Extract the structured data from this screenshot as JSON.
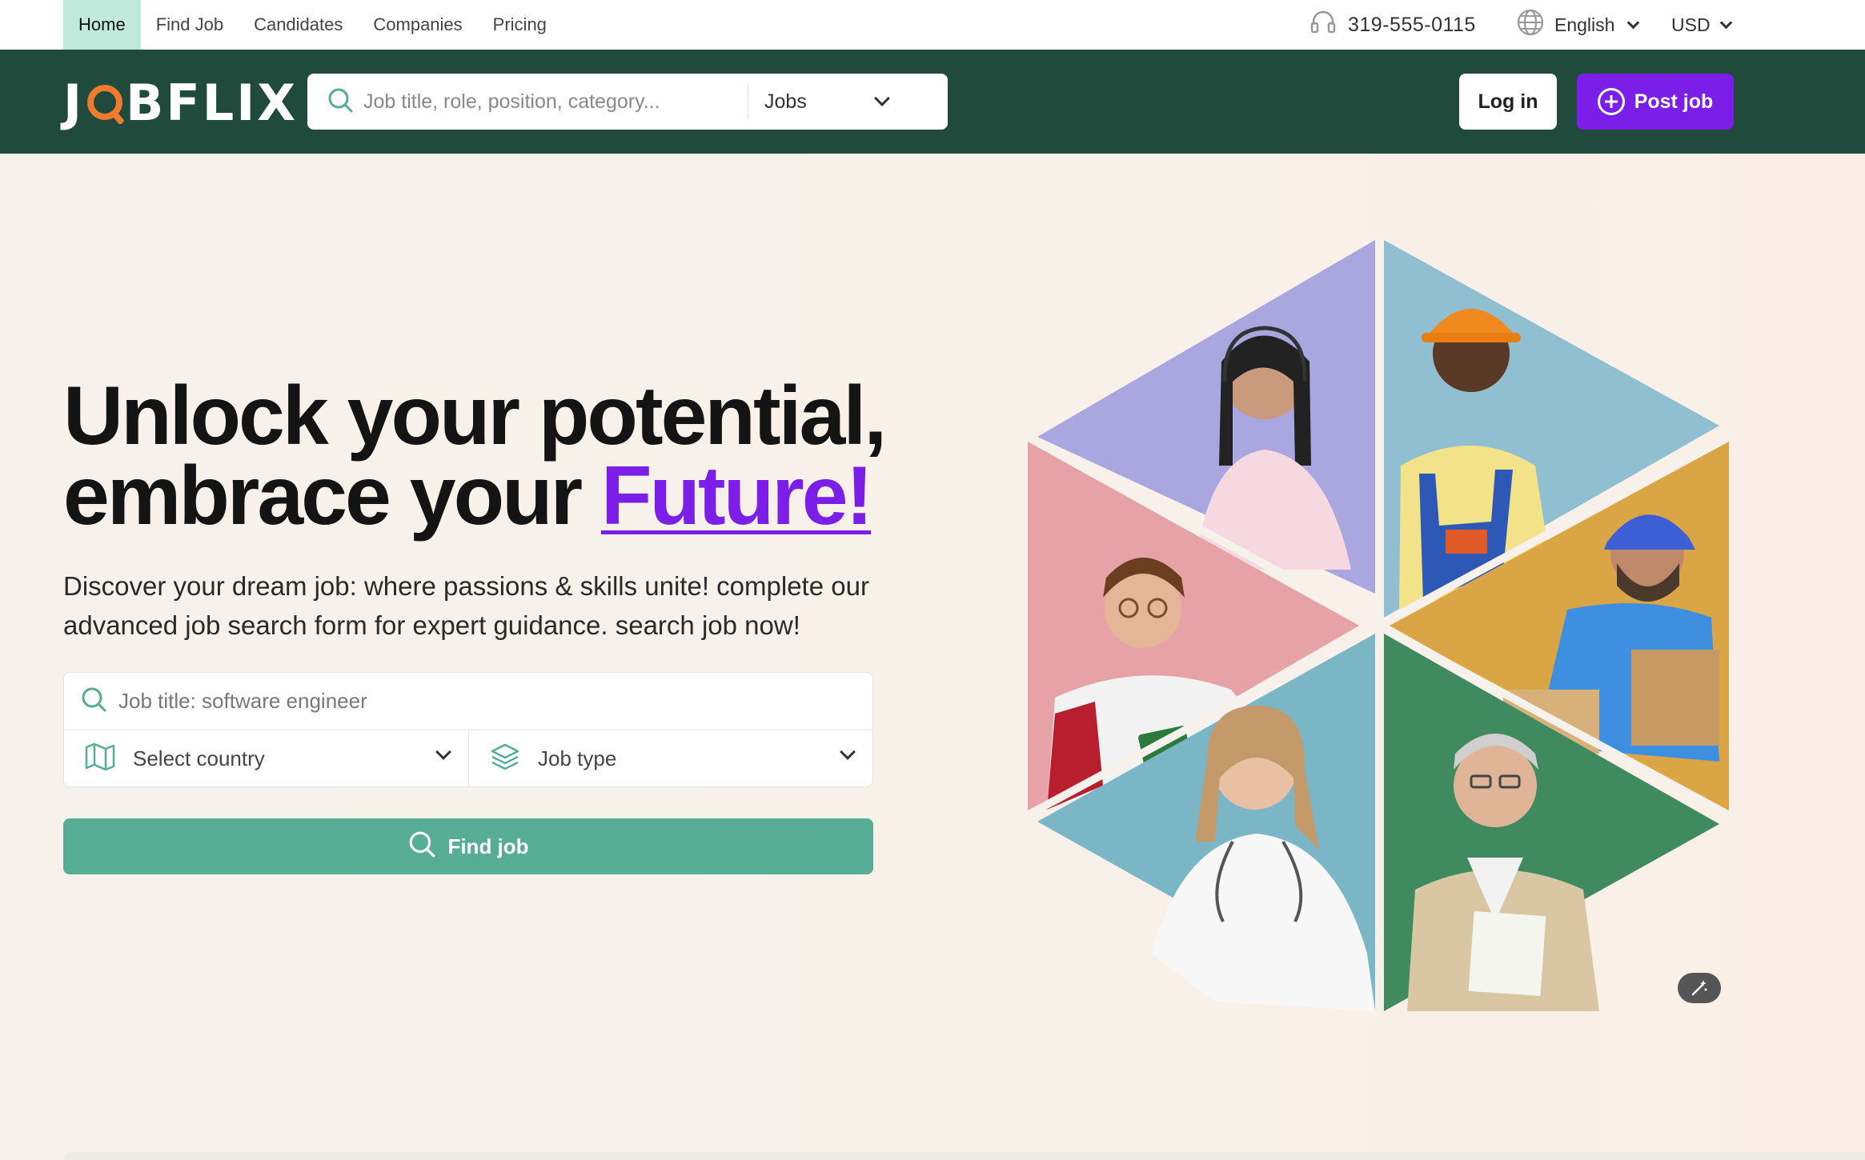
{
  "topbar": {
    "nav": [
      {
        "label": "Home",
        "active": true
      },
      {
        "label": "Find Job",
        "active": false
      },
      {
        "label": "Candidates",
        "active": false
      },
      {
        "label": "Companies",
        "active": false
      },
      {
        "label": "Pricing",
        "active": false
      }
    ],
    "phone": "319-555-0115",
    "language": "English",
    "currency": "USD",
    "icons": {
      "phone": "headset-icon",
      "language": "globe-icon"
    }
  },
  "header": {
    "logo_pre": "J",
    "logo_post": "BFLIX",
    "search_placeholder": "Job title, role, position, category...",
    "search_category": "Jobs",
    "login_label": "Log in",
    "post_label": "Post job",
    "colors": {
      "bg": "#1f4a3c",
      "accent": "#7a1ee8",
      "logo_accent": "#f07a2d"
    }
  },
  "hero": {
    "headline_line1": "Unlock your potential,",
    "headline_line2_prefix": "embrace your ",
    "headline_highlight": "Future!",
    "subtext": "Discover your dream job: where passions & skills unite! complete our advanced job search form for expert guidance. search job now!",
    "form": {
      "title_placeholder": "Job title: software engineer",
      "country_label": "Select country",
      "job_type_label": "Job type",
      "find_label": "Find job",
      "colors": {
        "find_button": "#56ad93"
      }
    },
    "image_tiles": [
      {
        "name": "call-center-agent-photo",
        "color": "#a9a6e0"
      },
      {
        "name": "construction-worker-photo",
        "color": "#8fbfd0"
      },
      {
        "name": "student-photo",
        "color": "#e7a2a8"
      },
      {
        "name": "delivery-worker-photo",
        "color": "#d9a545"
      },
      {
        "name": "doctor-photo",
        "color": "#7bb6c7"
      },
      {
        "name": "teacher-photo",
        "color": "#3f8a5e"
      }
    ]
  }
}
